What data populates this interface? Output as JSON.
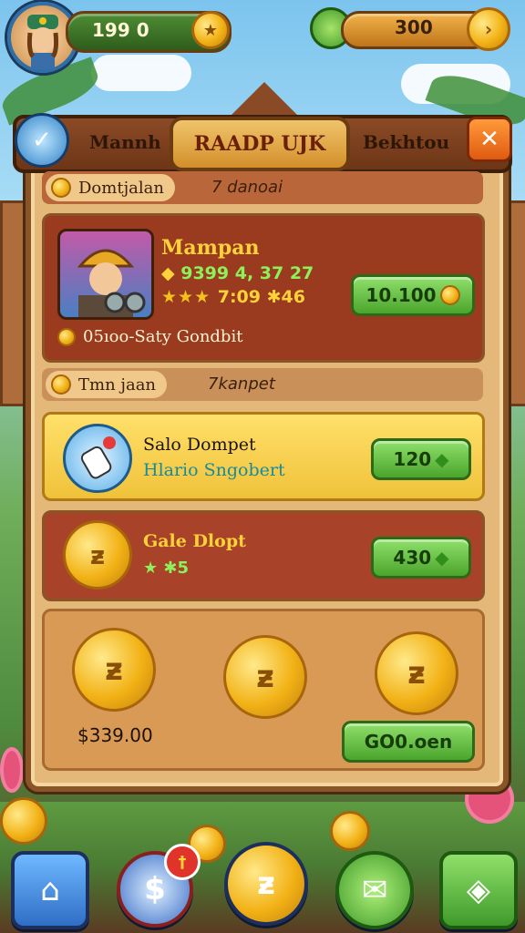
{
  "hud": {
    "left_value": "199 0",
    "right_value": "300"
  },
  "header": {
    "tab_left": "Mannh",
    "title": "RAADP UJK",
    "tab_right": "Bekhtou"
  },
  "section1": {
    "label": "Domtjalan",
    "right_text": "7 danoai",
    "card": {
      "name": "Mampan",
      "line1": "9399 4, 37 27",
      "line2": "7:09 ✱46",
      "price": "10.100",
      "footer": "05ıoo-Saty Gondbit"
    }
  },
  "section2": {
    "label": "Tmn jaan",
    "right_text": "7kanpet",
    "items": [
      {
        "title": "Salo Dompet",
        "subtitle": "Hlario Sngobert",
        "price": "120"
      },
      {
        "title": "Gale Dlopt",
        "subtitle": "★ ✱5",
        "price": "430"
      }
    ]
  },
  "coin_pack": {
    "price_label": "$339.00",
    "button": "GO0.oen"
  },
  "nav": {
    "badge": "†"
  }
}
